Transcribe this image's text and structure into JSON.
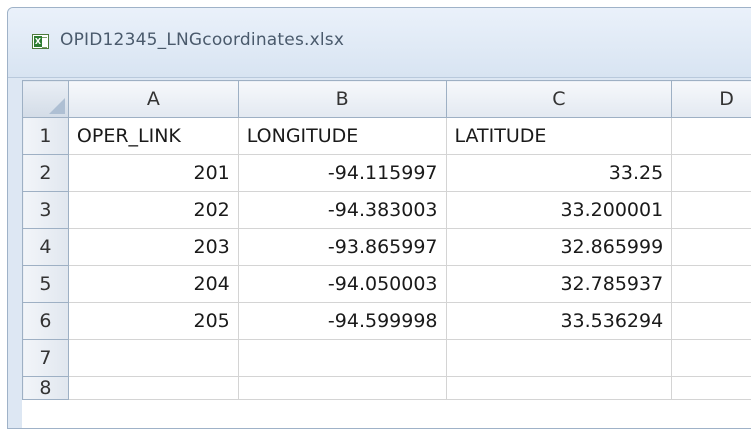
{
  "window": {
    "title": "OPID12345_LNGcoordinates.xlsx"
  },
  "icons": {
    "title_icon": "excel-file-icon"
  },
  "colors": {
    "header_bg": "#e3e9f1",
    "grid_line": "#d4d4d4",
    "frame": "#9fb2c8"
  },
  "sheet": {
    "columns": [
      "A",
      "B",
      "C",
      "D"
    ],
    "rows": [
      {
        "num": "1",
        "cells": [
          "OPER_LINK",
          "LONGITUDE",
          "LATITUDE",
          ""
        ]
      },
      {
        "num": "2",
        "cells": [
          "201",
          "-94.115997",
          "33.25",
          ""
        ]
      },
      {
        "num": "3",
        "cells": [
          "202",
          "-94.383003",
          "33.200001",
          ""
        ]
      },
      {
        "num": "4",
        "cells": [
          "203",
          "-93.865997",
          "32.865999",
          ""
        ]
      },
      {
        "num": "5",
        "cells": [
          "204",
          "-94.050003",
          "32.785937",
          ""
        ]
      },
      {
        "num": "6",
        "cells": [
          "205",
          "-94.599998",
          "33.536294",
          ""
        ]
      },
      {
        "num": "7",
        "cells": [
          "",
          "",
          "",
          ""
        ]
      },
      {
        "num": "8",
        "cells": [
          "",
          "",
          "",
          ""
        ]
      }
    ]
  }
}
